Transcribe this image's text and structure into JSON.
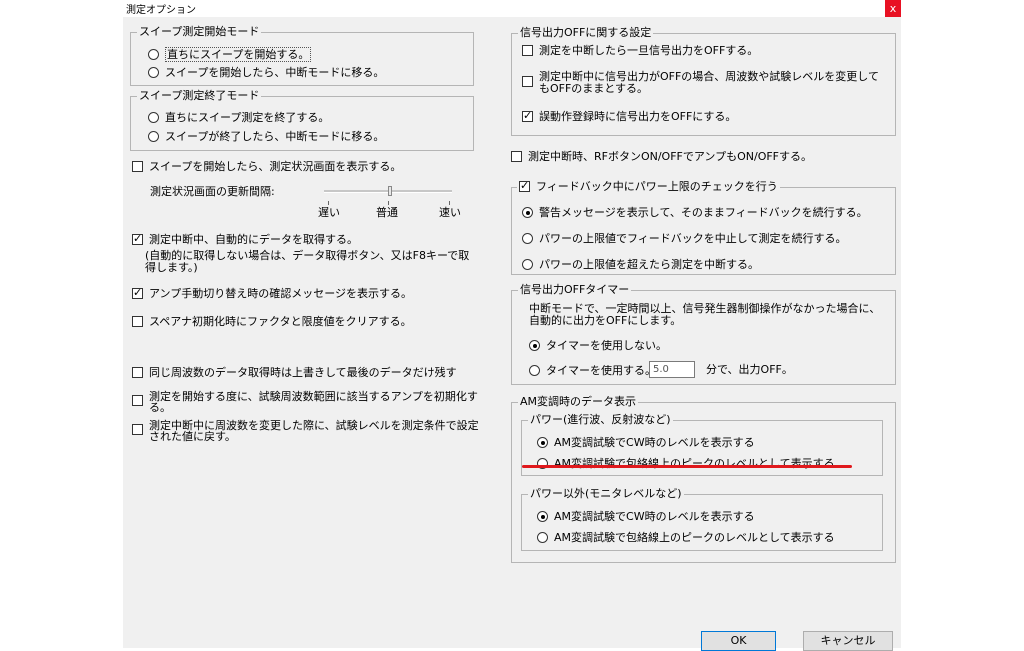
{
  "window": {
    "title": "測定オプション",
    "close_label": "x"
  },
  "sweep_start": {
    "legend": "スイープ測定開始モード",
    "options": [
      "直ちにスイープを開始する。",
      "スイープを開始したら、中断モードに移る。"
    ],
    "selected": 0
  },
  "sweep_end": {
    "legend": "スイープ測定終了モード",
    "options": [
      "直ちにスイープ測定を終了する。",
      "スイープが終了したら、中断モードに移る。"
    ],
    "selected": 0
  },
  "show_status_on_start": {
    "label": "スイープを開始したら、測定状況画面を表示する。",
    "checked": false
  },
  "update_interval": {
    "label": "測定状況画面の更新間隔:",
    "ticks": [
      "遅い",
      "普通",
      "速い"
    ],
    "value_fraction": 0.5
  },
  "auto_acquire": {
    "label": "測定中断中、自動的にデータを取得する。",
    "checked": true,
    "note": "(自動的に取得しない場合は、データ取得ボタン、又はF8キーで取得します。)"
  },
  "amp_switch_confirm": {
    "label": "アンプ手動切り替え時の確認メッセージを表示する。",
    "checked": true
  },
  "spana_init_clear": {
    "label": "スペアナ初期化時にファクタと限度値をクリアする。",
    "checked": false
  },
  "overwrite_same_freq": {
    "label": "同じ周波数のデータ取得時は上書きして最後のデータだけ残す",
    "checked": false
  },
  "init_amp_on_start": {
    "label": "測定を開始する度に、試験周波数範囲に該当するアンプを初期化する。",
    "checked": false
  },
  "restore_level_on_freq_change": {
    "label": "測定中断中に周波数を変更した際に、試験レベルを測定条件で設定された値に戻す。",
    "checked": false
  },
  "signal_off": {
    "legend": "信号出力OFFに関する設定",
    "items": [
      {
        "label": "測定を中断したら一旦信号出力をOFFする。",
        "checked": false
      },
      {
        "label": "測定中断中に信号出力がOFFの場合、周波数や試験レベルを変更してもOFFのままとする。",
        "checked": false
      },
      {
        "label": "誤動作登録時に信号出力をOFFにする。",
        "checked": true
      }
    ]
  },
  "rf_button_amp": {
    "label": "測定中断時、RFボタンON/OFFでアンプもON/OFFする。",
    "checked": false
  },
  "feedback_power_limit": {
    "legend": "フィードバック中にパワー上限のチェックを行う",
    "checked": true,
    "options": [
      "警告メッセージを表示して、そのままフィードバックを続行する。",
      "パワーの上限値でフィードバックを中止して測定を続行する。",
      "パワーの上限値を超えたら測定を中断する。"
    ],
    "selected": 0
  },
  "signal_off_timer": {
    "legend": "信号出力OFFタイマー",
    "description": "中断モードで、一定時間以上、信号発生器制御操作がなかった場合に、自動的に出力をOFFにします。",
    "options": [
      "タイマーを使用しない。",
      "タイマーを使用する。"
    ],
    "selected": 0,
    "value": "5.0",
    "suffix": "分で、出力OFF。"
  },
  "am_display": {
    "legend": "AM変調時のデータ表示",
    "power": {
      "legend": "パワー(進行波、反射波など)",
      "options": [
        "AM変調試験でCW時のレベルを表示する",
        "AM変調試験で包絡線上のピークのレベルとして表示する"
      ],
      "selected": 0
    },
    "non_power": {
      "legend": "パワー以外(モニタレベルなど)",
      "options": [
        "AM変調試験でCW時のレベルを表示する",
        "AM変調試験で包絡線上のピークのレベルとして表示する"
      ],
      "selected": 0
    }
  },
  "buttons": {
    "ok": "OK",
    "cancel": "キャンセル"
  },
  "colors": {
    "highlight_underline": "#e0191d",
    "close_button": "#e81123"
  }
}
